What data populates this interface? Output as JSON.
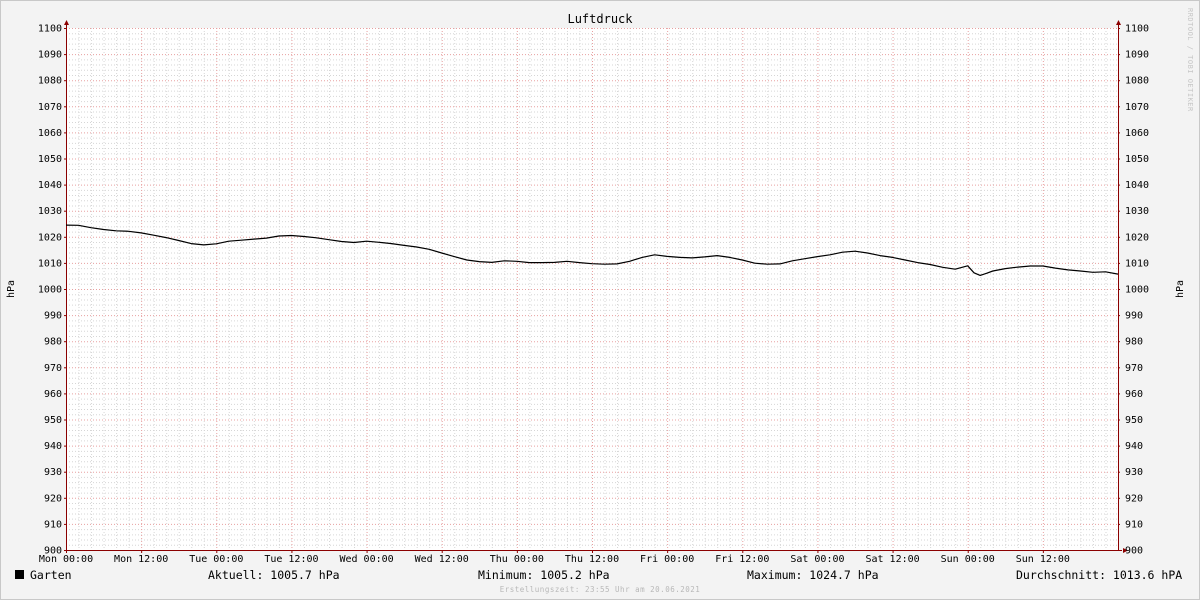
{
  "chart_data": {
    "type": "line",
    "title": "Luftdruck",
    "ylabel": "hPa",
    "ylabel_right": "hPa",
    "ylim": [
      900,
      1100
    ],
    "y_ticks": [
      900,
      910,
      920,
      930,
      940,
      950,
      960,
      970,
      980,
      990,
      1000,
      1010,
      1020,
      1030,
      1040,
      1050,
      1060,
      1070,
      1080,
      1090,
      1100
    ],
    "x_tick_labels": [
      "Mon 00:00",
      "Mon 12:00",
      "Tue 00:00",
      "Tue 12:00",
      "Wed 00:00",
      "Wed 12:00",
      "Thu 00:00",
      "Thu 12:00",
      "Fri 00:00",
      "Fri 12:00",
      "Sat 00:00",
      "Sat 12:00",
      "Sun 00:00",
      "Sun 12:00"
    ],
    "x_unit": "hours since Mon 00:00",
    "xlim": [
      0,
      168
    ],
    "grid": true,
    "series": [
      {
        "name": "Garten",
        "color": "#000000",
        "x": [
          0,
          2,
          4,
          6,
          8,
          10,
          12,
          14,
          16,
          18,
          20,
          22,
          24,
          26,
          28,
          30,
          32,
          34,
          36,
          38,
          40,
          42,
          44,
          46,
          48,
          50,
          52,
          54,
          56,
          58,
          60,
          62,
          64,
          66,
          68,
          70,
          72,
          74,
          76,
          78,
          80,
          82,
          84,
          86,
          88,
          90,
          92,
          94,
          96,
          98,
          100,
          102,
          104,
          106,
          108,
          110,
          112,
          114,
          116,
          118,
          120,
          122,
          124,
          126,
          128,
          130,
          132,
          134,
          136,
          138,
          140,
          142,
          144,
          145,
          146,
          147,
          148,
          150,
          152,
          154,
          156,
          158,
          160,
          162,
          164,
          166,
          168
        ],
        "y": [
          1024.5,
          1024.4,
          1023.5,
          1022.8,
          1022.3,
          1022.1,
          1021.5,
          1020.6,
          1019.7,
          1018.6,
          1017.4,
          1016.9,
          1017.3,
          1018.3,
          1018.7,
          1019.1,
          1019.5,
          1020.3,
          1020.5,
          1020.1,
          1019.6,
          1018.9,
          1018.2,
          1017.8,
          1018.3,
          1017.9,
          1017.4,
          1016.7,
          1016.1,
          1015.2,
          1013.8,
          1012.4,
          1011.1,
          1010.5,
          1010.2,
          1010.8,
          1010.6,
          1010.1,
          1010.1,
          1010.2,
          1010.6,
          1010.1,
          1009.7,
          1009.5,
          1009.6,
          1010.6,
          1012.1,
          1013.1,
          1012.5,
          1012.1,
          1011.9,
          1012.3,
          1012.8,
          1012.1,
          1011.1,
          1009.9,
          1009.5,
          1009.6,
          1010.8,
          1011.6,
          1012.4,
          1013.1,
          1014.1,
          1014.5,
          1013.8,
          1012.8,
          1012.1,
          1011.1,
          1010.1,
          1009.4,
          1008.3,
          1007.6,
          1008.9,
          1006.2,
          1005.2,
          1006.0,
          1006.9,
          1007.8,
          1008.4,
          1008.8,
          1008.8,
          1008.0,
          1007.3,
          1006.9,
          1006.4,
          1006.6,
          1005.7
        ]
      }
    ]
  },
  "legend": {
    "series_name": "Garten",
    "swatch_color": "#000000"
  },
  "stats": {
    "aktuell": "Aktuell: 1005.7 hPa",
    "minimum": "Minimum: 1005.2 hPa",
    "maximum": "Maximum: 1024.7 hPa",
    "durchschnitt": "Durchschnitt: 1013.6 hPA"
  },
  "credit": "Erstellungszeit: 23:55 Uhr am 20.06.2021",
  "watermark": "RRDTOOL / TOBI OETIKER",
  "colors": {
    "background": "#f3f3f3",
    "plot_background": "#ffffff",
    "major_grid": "#e8a0a0",
    "minor_grid": "#d6d6d6",
    "axis": "#8b0000"
  }
}
